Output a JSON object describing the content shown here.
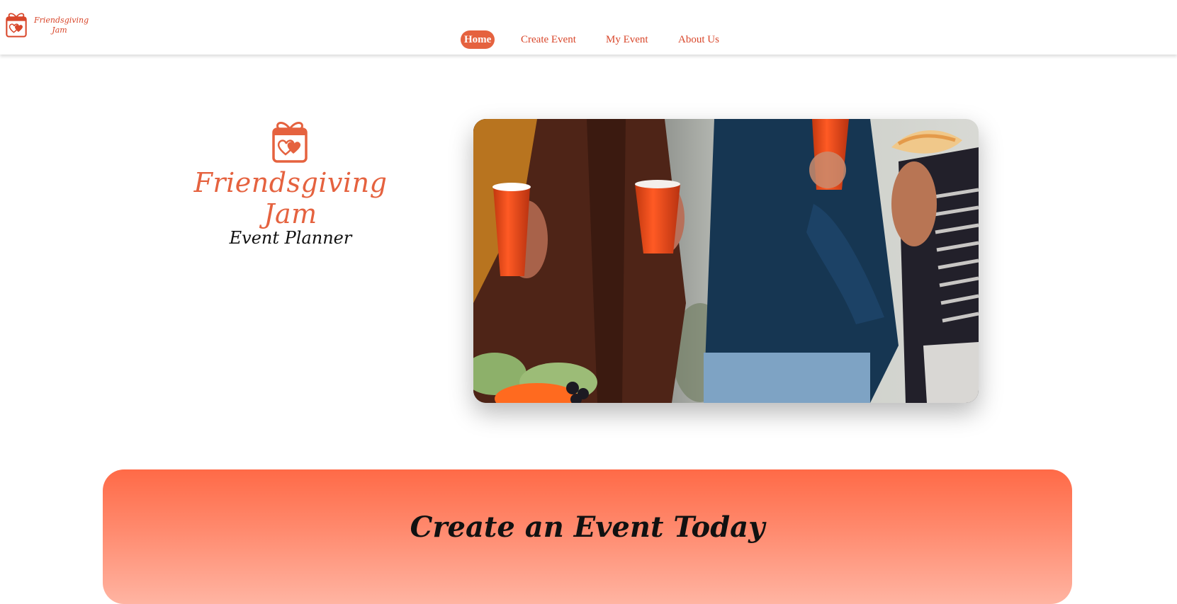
{
  "brand": {
    "name_line1": "Friendsgiving",
    "name_line2": "Jam",
    "logo_icon": "gift-heart-icon",
    "accent_color": "#e5623f"
  },
  "nav": {
    "items": [
      {
        "label": "Home",
        "active": true
      },
      {
        "label": "Create Event",
        "active": false
      },
      {
        "label": "My Event",
        "active": false
      },
      {
        "label": "About Us",
        "active": false
      }
    ]
  },
  "hero": {
    "icon": "gift-heart-icon",
    "title": "Friendsgiving Jam",
    "subtitle": "Event Planner",
    "photo": "friends-holding-red-cups-photo"
  },
  "cta": {
    "title": "Create an Event Today",
    "gradient_top": "#ff6a47",
    "gradient_bottom": "#ffb4a2"
  }
}
